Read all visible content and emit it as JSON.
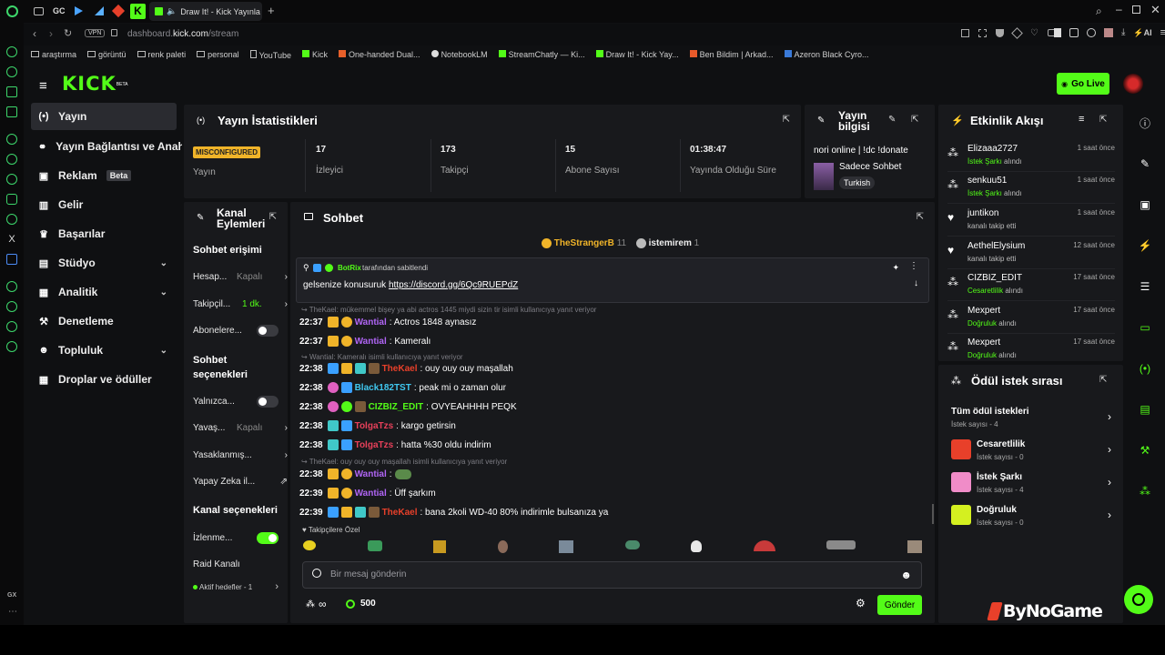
{
  "browser": {
    "tab_title": "Draw It! - Kick Yayınları",
    "url_prefix": "dashboard.",
    "url_domain": "kick.com",
    "url_path": "/stream",
    "vpn_label": "VPN",
    "bookmarks": [
      "araştırma",
      "görüntü",
      "renk paleti",
      "personal",
      "YouTube",
      "Kick",
      "One-handed Dual...",
      "NotebookLM",
      "StreamChatly — Ki...",
      "Draw It! - Kick Yay...",
      "Ben Bildim | Arkad...",
      "Azeron Black Cyro..."
    ],
    "gx_label": "GX",
    "gc_label": "GC"
  },
  "header": {
    "logo": "KICK",
    "logo_sup": "BETA",
    "go_live": "Go Live"
  },
  "sidebar": {
    "items": [
      {
        "label": "Yayın",
        "icon": "broadcast-icon"
      },
      {
        "label": "Yayın Bağlantısı ve Anahtar",
        "icon": "link-icon"
      },
      {
        "label": "Reklam",
        "icon": "ad-icon",
        "badge": "Beta"
      },
      {
        "label": "Gelir",
        "icon": "chart-icon"
      },
      {
        "label": "Başarılar",
        "icon": "trophy-icon"
      },
      {
        "label": "Stüdyo",
        "icon": "studio-icon"
      },
      {
        "label": "Analitik",
        "icon": "analytics-icon"
      },
      {
        "label": "Denetleme",
        "icon": "hammer-icon"
      },
      {
        "label": "Topluluk",
        "icon": "community-icon"
      },
      {
        "label": "Droplar ve ödüller",
        "icon": "gift-icon"
      }
    ]
  },
  "stats": {
    "title": "Yayın İstatistikleri",
    "status_badge": "MISCONFIGURED",
    "status_label": "Yayın",
    "items": [
      {
        "value": "17",
        "label": "İzleyici"
      },
      {
        "value": "173",
        "label": "Takipçi"
      },
      {
        "value": "15",
        "label": "Abone Sayısı"
      },
      {
        "value": "01:38:47",
        "label": "Yayında Olduğu Süre"
      }
    ]
  },
  "stream_info": {
    "title_line1": "Yayın",
    "title_line2": "bilgisi",
    "stream_title": "nori online | !dc !donate",
    "category": "Sadece Sohbet",
    "language": "Turkish"
  },
  "channel_actions": {
    "title_line1": "Kanal",
    "title_line2": "Eylemleri",
    "chat_access_title": "Sohbet erişimi",
    "access_rows": [
      {
        "label": "Hesap...",
        "value": "Kapalı"
      },
      {
        "label": "Takipçil...",
        "value": "1 dk."
      },
      {
        "label": "Abonelere...",
        "value": ""
      }
    ],
    "chat_options_title_1": "Sohbet",
    "chat_options_title_2": "seçenekleri",
    "option_rows": [
      {
        "label": "Yalnızca...",
        "value": ""
      },
      {
        "label": "Yavaş...",
        "value": "Kapalı"
      },
      {
        "label": "Yasaklanmış...",
        "value": ""
      },
      {
        "label": "Yapay Zeka il...",
        "value": ""
      }
    ],
    "channel_options_title": "Kanal seçenekleri",
    "channel_rows": [
      {
        "label": "İzlenme...",
        "value": ""
      },
      {
        "label": "Raid Kanalı",
        "value": ""
      }
    ],
    "active_targets": "Aktif hedefler - 1"
  },
  "chat": {
    "title": "Sohbet",
    "top_user_1": "TheStrangerB",
    "top_count_1": "11",
    "top_user_2": "istemirem",
    "top_count_2": "1",
    "pinned_by_name": "BotRix",
    "pinned_by_suffix": "tarafından sabitlendi",
    "pinned_message": "gelsenize konusuruk",
    "pinned_link": "https://discord.gg/6Qc9RUEPdZ",
    "reply_1": "TheKael: mükemmel bişey ya abi actros 1445 miydi sizin tir isimli kullanıcıya yanıt veriyor",
    "reply_2": "Wantial: Kameralı isimli kullanıcıya yanıt veriyor",
    "reply_3": "TheKael: ouy ouy ouy maşallah isimli kullanıcıya yanıt veriyor",
    "messages": [
      {
        "time": "22:37",
        "user": "Wantial",
        "text": ": Actros 1848 aynasız"
      },
      {
        "time": "22:37",
        "user": "Wantial",
        "text": ": Kameralı"
      },
      {
        "time": "22:38",
        "user": "TheKael",
        "text": ": ouy ouy ouy maşallah"
      },
      {
        "time": "22:38",
        "user": "Black182TST",
        "text": ": peak mi o zaman olur"
      },
      {
        "time": "22:38",
        "user": "CIZBIZ_EDIT",
        "text": ": OVYEAHHHH PEQK"
      },
      {
        "time": "22:38",
        "user": "TolgaTzs",
        "text": ": kargo getirsin"
      },
      {
        "time": "22:38",
        "user": "TolgaTzs",
        "text": ": hatta %30 oldu indirim"
      },
      {
        "time": "22:38",
        "user": "Wantial",
        "text": ":"
      },
      {
        "time": "22:39",
        "user": "Wantial",
        "text": ": Üff şarkım"
      },
      {
        "time": "22:39",
        "user": "TheKael",
        "text": ": bana 2koli WD-40 80% indirimle bulsanıza ya"
      }
    ],
    "followers_only_label": "Takipçilere Özel",
    "input_placeholder": "Bir mesaj gönderin",
    "points": "500",
    "send_button": "Gönder"
  },
  "activity": {
    "title": "Etkinlik Akışı",
    "rows": [
      {
        "name": "Elizaaa2727",
        "time": "1 saat önce",
        "highlight": "İstek Şarkı",
        "suffix": " alındı",
        "icon": "reward-icon"
      },
      {
        "name": "senkuu51",
        "time": "1 saat önce",
        "highlight": "İstek Şarkı",
        "suffix": " alındı",
        "icon": "reward-icon"
      },
      {
        "name": "juntikon",
        "time": "1 saat önce",
        "highlight": "",
        "suffix": "kanalı takip etti",
        "icon": "heart-icon"
      },
      {
        "name": "AethelElysium",
        "time": "12 saat önce",
        "highlight": "",
        "suffix": "kanalı takip etti",
        "icon": "heart-icon"
      },
      {
        "name": "CIZBIZ_EDIT",
        "time": "17 saat önce",
        "highlight": "Cesaretlilik",
        "suffix": " alındı",
        "icon": "reward-icon"
      },
      {
        "name": "Mexpert",
        "time": "17 saat önce",
        "highlight": "Doğruluk",
        "suffix": " alındı",
        "icon": "reward-icon"
      },
      {
        "name": "Mexpert",
        "time": "17 saat önce",
        "highlight": "Doğruluk",
        "suffix": " alındı",
        "icon": "reward-icon"
      }
    ]
  },
  "rewards": {
    "title": "Ödül istek sırası",
    "all_title": "Tüm ödül istekleri",
    "all_count": "İstek sayısı - 4",
    "items": [
      {
        "name": "Cesaretlilik",
        "count": "İstek sayısı - 0",
        "color": "#e8402a"
      },
      {
        "name": "İstek Şarkı",
        "count": "İstek sayısı - 4",
        "color": "#f08cc8"
      },
      {
        "name": "Doğruluk",
        "count": "İstek sayısı - 0",
        "color": "#d4f020"
      }
    ]
  },
  "watermark": "ByNoGame",
  "colors": {
    "accent": "#53fc18",
    "panel": "#18191c",
    "background": "#0f1012"
  }
}
